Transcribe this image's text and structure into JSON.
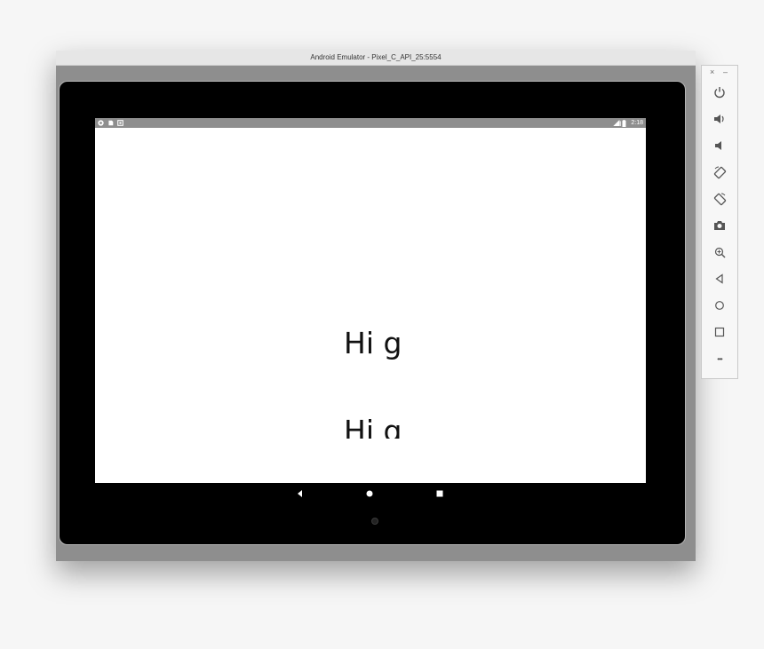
{
  "window": {
    "title": "Android Emulator - Pixel_C_API_25:5554"
  },
  "statusbar": {
    "left_icons": [
      "android-icon",
      "sd-card-icon",
      "notification-icon"
    ],
    "right_icons": [
      "signal-icon",
      "battery-icon"
    ],
    "time": "2:18"
  },
  "app": {
    "line1": "Hi g",
    "line2": "Hi g"
  },
  "navbar": {
    "buttons": [
      "back-icon",
      "home-icon",
      "recents-icon"
    ]
  },
  "sidebar": {
    "close_label": "×",
    "minimize_label": "–",
    "buttons": [
      "power-icon",
      "volume-up-icon",
      "volume-down-icon",
      "rotate-left-icon",
      "rotate-right-icon",
      "camera-icon",
      "zoom-icon",
      "back-icon",
      "home-icon",
      "overview-icon",
      "more-icon"
    ],
    "more_label": "•••"
  },
  "colors": {
    "frame": "#000000",
    "window_bg": "#8e8e8e",
    "statusbar": "#8e8e8e",
    "sidebar_icon": "#555555"
  }
}
